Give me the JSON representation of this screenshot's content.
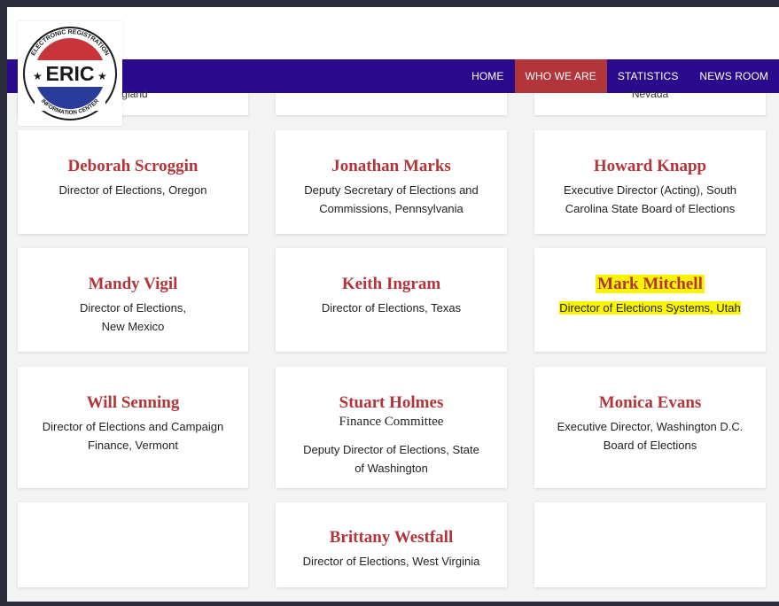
{
  "nav": {
    "items": [
      {
        "label": "HOME",
        "active": false
      },
      {
        "label": "WHO WE ARE",
        "active": true
      },
      {
        "label": "STATISTICS",
        "active": false
      },
      {
        "label": "NEWS ROOM",
        "active": false
      }
    ]
  },
  "logo": {
    "text": "ERIC",
    "top_arc": "ELECTRONIC REGISTRATION",
    "bottom_arc": "INFORMATION CENTER"
  },
  "cut_row": {
    "left": "rgland",
    "right": "Nevada"
  },
  "cards": {
    "c1": {
      "name": "Deborah Scroggin",
      "title": "Director of Elections, Oregon"
    },
    "c2": {
      "name": "Jonathan Marks",
      "title_l1": "Deputy Secretary of Elections and",
      "title_l2": "Commissions, Pennsylvania"
    },
    "c3": {
      "name": "Howard Knapp",
      "title_l1": "Executive Director (Acting), South",
      "title_l2": "Carolina State Board of Elections"
    },
    "c4": {
      "name": "Mandy Vigil",
      "title_l1": "Director of Elections,",
      "title_l2": "New Mexico"
    },
    "c5": {
      "name": "Keith Ingram",
      "title": "Director of Elections, Texas"
    },
    "c6": {
      "name": "Mark Mitchell",
      "title": "Director of Elections Systems, Utah"
    },
    "c7": {
      "name": "Will Senning",
      "title_l1": "Director of Elections and Campaign",
      "title_l2": "Finance, Vermont"
    },
    "c8": {
      "name": "Stuart Holmes",
      "sub": "Finance Committee",
      "title_l1": "Deputy Director of Elections, State",
      "title_l2": "of Washington"
    },
    "c9": {
      "name": "Monica Evans",
      "title_l1": "Executive Director, Washington D.C.",
      "title_l2": "Board of Elections"
    },
    "c10": {
      "name": "Brittany Westfall",
      "title": "Director of Elections, West Virginia"
    }
  },
  "colors": {
    "navbar": "#2a0a8c",
    "active": "#b2353a",
    "name": "#b2353a",
    "highlight": "#fbf400"
  }
}
